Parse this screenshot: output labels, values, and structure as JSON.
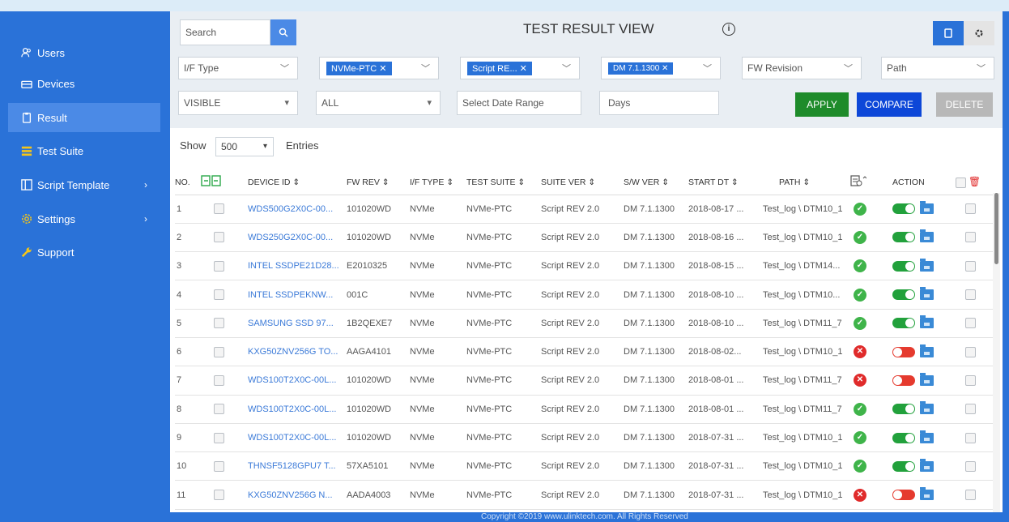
{
  "sidebar": {
    "items": [
      {
        "label": "Users",
        "icon": "users-icon"
      },
      {
        "label": "Devices",
        "icon": "devices-icon"
      },
      {
        "label": "Result",
        "icon": "clipboard-icon",
        "active": true
      },
      {
        "label": "Test Suite",
        "icon": "list-icon"
      },
      {
        "label": "Script Template",
        "icon": "template-icon",
        "chevron": "›"
      },
      {
        "label": "Settings",
        "icon": "gear-icon",
        "chevron": "›"
      },
      {
        "label": "Support",
        "icon": "wrench-icon"
      }
    ]
  },
  "header": {
    "search_placeholder": "Search",
    "title": "TEST RESULT VIEW",
    "info": "i"
  },
  "filters": {
    "if_type": "I/F Type",
    "if_type_tag": "NVMe-PTC",
    "suite_tag": "Script RE...",
    "sw_tag": "DM 7.1.1300",
    "fw_revision": "FW Revision",
    "path": "Path",
    "visible": "VISIBLE",
    "all": "ALL",
    "date_range": "Select Date Range",
    "days": "Days",
    "apply": "APPLY",
    "compare": "COMPARE",
    "delete": "DELETE"
  },
  "entries": {
    "show": "Show",
    "value": "500",
    "label": "Entries"
  },
  "table": {
    "headers": [
      "NO.",
      "",
      "DEVICE ID ⇕",
      "FW REV ⇕",
      "I/F TYPE ⇕",
      "TEST SUITE ⇕",
      "SUITE VER ⇕",
      "S/W VER ⇕",
      "START DT ⇕",
      "PATH ⇕",
      "",
      "ACTION",
      ""
    ],
    "rows": [
      {
        "no": "1",
        "device": "WDS500G2X0C-00...",
        "fw": "101020WD",
        "if": "NVMe",
        "suite": "NVMe-PTC",
        "ver": "Script REV 2.0",
        "sw": "DM 7.1.1300",
        "dt": "2018-08-17 ...",
        "path": "Test_log \\ DTM10_1",
        "pass": true
      },
      {
        "no": "2",
        "device": "WDS250G2X0C-00...",
        "fw": "101020WD",
        "if": "NVMe",
        "suite": "NVMe-PTC",
        "ver": "Script REV 2.0",
        "sw": "DM 7.1.1300",
        "dt": "2018-08-16 ...",
        "path": "Test_log \\ DTM10_1",
        "pass": true
      },
      {
        "no": "3",
        "device": "INTEL SSDPE21D28...",
        "fw": "E2010325",
        "if": "NVMe",
        "suite": "NVMe-PTC",
        "ver": "Script REV 2.0",
        "sw": "DM 7.1.1300",
        "dt": "2018-08-15 ...",
        "path": "Test_log \\ DTM14...",
        "pass": true
      },
      {
        "no": "4",
        "device": "INTEL SSDPEKNW...",
        "fw": "001C",
        "if": "NVMe",
        "suite": "NVMe-PTC",
        "ver": "Script REV 2.0",
        "sw": "DM 7.1.1300",
        "dt": "2018-08-10 ...",
        "path": "Test_log \\ DTM10...",
        "pass": true
      },
      {
        "no": "5",
        "device": "SAMSUNG SSD 97...",
        "fw": "1B2QEXE7",
        "if": "NVMe",
        "suite": "NVMe-PTC",
        "ver": "Script REV 2.0",
        "sw": "DM 7.1.1300",
        "dt": "2018-08-10 ...",
        "path": "Test_log \\ DTM11_7",
        "pass": true
      },
      {
        "no": "6",
        "device": "KXG50ZNV256G TO...",
        "fw": "AAGA4101",
        "if": "NVMe",
        "suite": "NVMe-PTC",
        "ver": "Script REV 2.0",
        "sw": "DM 7.1.1300",
        "dt": "2018-08-02...",
        "path": "Test_log \\ DTM10_1",
        "pass": false
      },
      {
        "no": "7",
        "device": "WDS100T2X0C-00L...",
        "fw": "101020WD",
        "if": "NVMe",
        "suite": "NVMe-PTC",
        "ver": "Script REV 2.0",
        "sw": "DM 7.1.1300",
        "dt": "2018-08-01 ...",
        "path": "Test_log \\ DTM11_7",
        "pass": false
      },
      {
        "no": "8",
        "device": "WDS100T2X0C-00L...",
        "fw": "101020WD",
        "if": "NVMe",
        "suite": "NVMe-PTC",
        "ver": "Script REV 2.0",
        "sw": "DM 7.1.1300",
        "dt": "2018-08-01 ...",
        "path": "Test_log \\ DTM11_7",
        "pass": true
      },
      {
        "no": "9",
        "device": "WDS100T2X0C-00L...",
        "fw": "101020WD",
        "if": "NVMe",
        "suite": "NVMe-PTC",
        "ver": "Script REV 2.0",
        "sw": "DM 7.1.1300",
        "dt": "2018-07-31 ...",
        "path": "Test_log \\ DTM10_1",
        "pass": true
      },
      {
        "no": "10",
        "device": "THNSF5128GPU7 T...",
        "fw": "57XA5101",
        "if": "NVMe",
        "suite": "NVMe-PTC",
        "ver": "Script REV 2.0",
        "sw": "DM 7.1.1300",
        "dt": "2018-07-31 ...",
        "path": "Test_log \\ DTM10_1",
        "pass": true
      },
      {
        "no": "11",
        "device": "KXG50ZNV256G N...",
        "fw": "AADA4003",
        "if": "NVMe",
        "suite": "NVMe-PTC",
        "ver": "Script REV 2.0",
        "sw": "DM 7.1.1300",
        "dt": "2018-07-31 ...",
        "path": "Test_log \\ DTM10_1",
        "pass": false
      }
    ]
  },
  "footer": "Copyright ©2019 www.ulinktech.com. All Rights Reserved",
  "colors": {
    "sidebar": "#2a72d8",
    "apply": "#1e8b2a",
    "compare": "#0d47d8",
    "delete": "#b8b8b8",
    "pass": "#3fb44a",
    "fail": "#e02b2b"
  }
}
